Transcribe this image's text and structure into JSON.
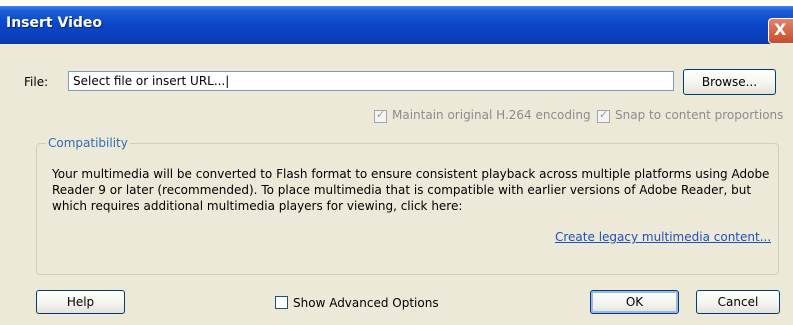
{
  "window": {
    "title": "Insert Video",
    "close_symbol": "X"
  },
  "file": {
    "label": "File:",
    "value": "Select file or insert URL...|",
    "browse_label": "Browse..."
  },
  "options": {
    "maintain_encoding": {
      "label": "Maintain original H.264 encoding",
      "checked": true,
      "enabled": false
    },
    "snap_proportions": {
      "label": "Snap to content proportions",
      "checked": true,
      "enabled": false
    }
  },
  "compatibility": {
    "legend": "Compatibility",
    "text": "Your multimedia will be converted to Flash format to ensure consistent playback across multiple platforms using Adobe Reader 9 or later (recommended). To place multimedia that is compatible with earlier versions of Adobe Reader, but which requires additional multimedia players for viewing, click here:",
    "link": "Create legacy multimedia content..."
  },
  "footer": {
    "help_label": "Help",
    "advanced_label": "Show Advanced Options",
    "advanced_checked": false,
    "ok_label": "OK",
    "cancel_label": "Cancel"
  },
  "colors": {
    "titlebar": "#0a46c8",
    "dialog_bg": "#ece9d8",
    "link": "#1f4fbd",
    "legend": "#2f6bb7"
  }
}
